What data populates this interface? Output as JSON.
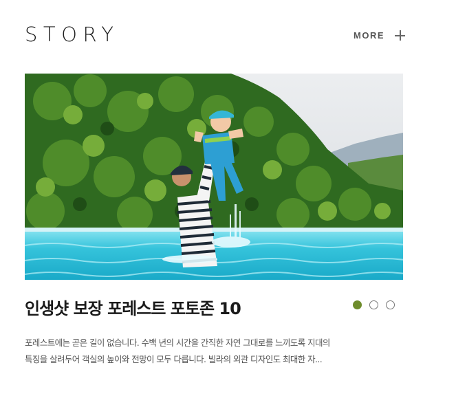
{
  "header": {
    "title": "STORY",
    "more_label": "MORE",
    "more_icon": "plus-icon"
  },
  "story": {
    "title": "인생샷 보장 포레스트 포토존 10",
    "description_line1": "포레스트에는 곧은 길이 없습니다. 수백 년의 시간을 간직한 자연 그대로를 느끼도록 지대의",
    "description_line2": "특징을 살려두어 객실의 높이와 전망이 모두 다릅니다. 빌라의 외관 디자인도 최대한 자..."
  },
  "carousel": {
    "total": 3,
    "active_index": 0
  },
  "colors": {
    "accent": "#6e8c2c",
    "title_text": "#1e1e1e",
    "body_text": "#555555"
  }
}
